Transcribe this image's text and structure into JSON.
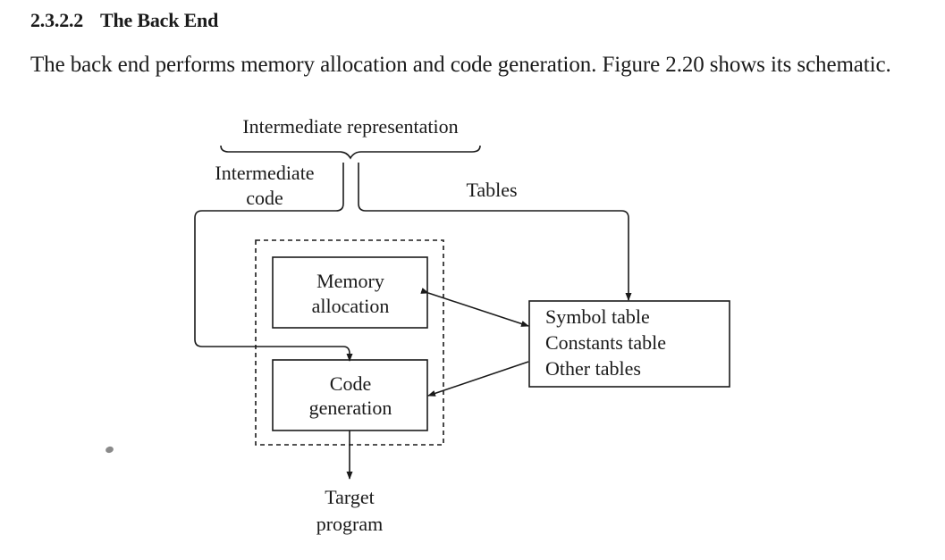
{
  "section": {
    "number": "2.3.2.2",
    "title": "The Back End"
  },
  "paragraph": "The back end performs memory allocation and code generation. Figure 2.20 shows its schematic.",
  "figure": {
    "top_label": "Intermediate representation",
    "branch_left_line1": "Intermediate",
    "branch_left_line2": "code",
    "branch_right": "Tables",
    "boxes": {
      "memory_allocation": [
        "Memory",
        "allocation"
      ],
      "code_generation": [
        "Code",
        "generation"
      ],
      "tables": [
        "Symbol table",
        "Constants table",
        "Other tables"
      ]
    },
    "output_label": [
      "Target",
      "program"
    ]
  }
}
